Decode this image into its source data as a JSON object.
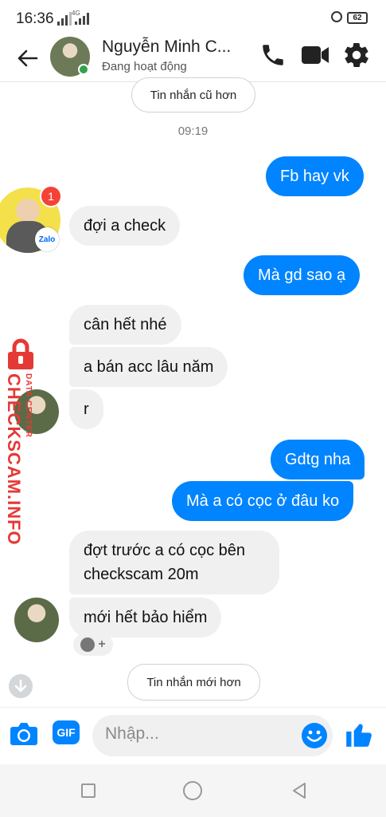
{
  "status_bar": {
    "time": "16:36",
    "network": "4G",
    "battery": "62"
  },
  "header": {
    "contact_name": "Nguyễn Minh C...",
    "contact_status": "Đang hoạt động"
  },
  "conversation": {
    "older_messages_label": "Tin nhắn cũ hơn",
    "newer_messages_label": "Tin nhắn mới hơn",
    "timestamp": "09:19",
    "messages": [
      {
        "side": "out",
        "text": "Fb hay vk"
      },
      {
        "side": "in",
        "text": "đợi a check"
      },
      {
        "side": "out",
        "text": "Mà gd sao ạ"
      },
      {
        "side": "in",
        "text": "cân hết nhé"
      },
      {
        "side": "in",
        "text": "a bán acc lâu năm"
      },
      {
        "side": "in",
        "text": "r"
      },
      {
        "side": "out",
        "text": "Gdtg nha"
      },
      {
        "side": "out",
        "text": "Mà a có cọc ở đâu ko"
      },
      {
        "side": "in",
        "text": "đợt trước a có cọc bên"
      },
      {
        "side": "in",
        "text": "checkscam 20m"
      },
      {
        "side": "in",
        "text": "mới hết bảo hiểm"
      }
    ]
  },
  "zalo_avatar": {
    "badge_label": "Zalo",
    "notification_count": "1"
  },
  "watermark": {
    "brand": "CHECKSCAM.INFO",
    "tagline": "DATA CENTER"
  },
  "composer": {
    "placeholder": "Nhập...",
    "gif_label": "GIF"
  },
  "colors": {
    "accent": "#0084ff",
    "incoming_bubble": "#f1f0f0",
    "online": "#31a24c",
    "watermark": "#e53935"
  },
  "icons": [
    "back-arrow-icon",
    "phone-icon",
    "video-camera-icon",
    "gear-icon",
    "camera-icon",
    "gif-icon",
    "emoji-icon",
    "thumbs-up-icon",
    "add-reaction-icon",
    "scroll-down-icon"
  ]
}
